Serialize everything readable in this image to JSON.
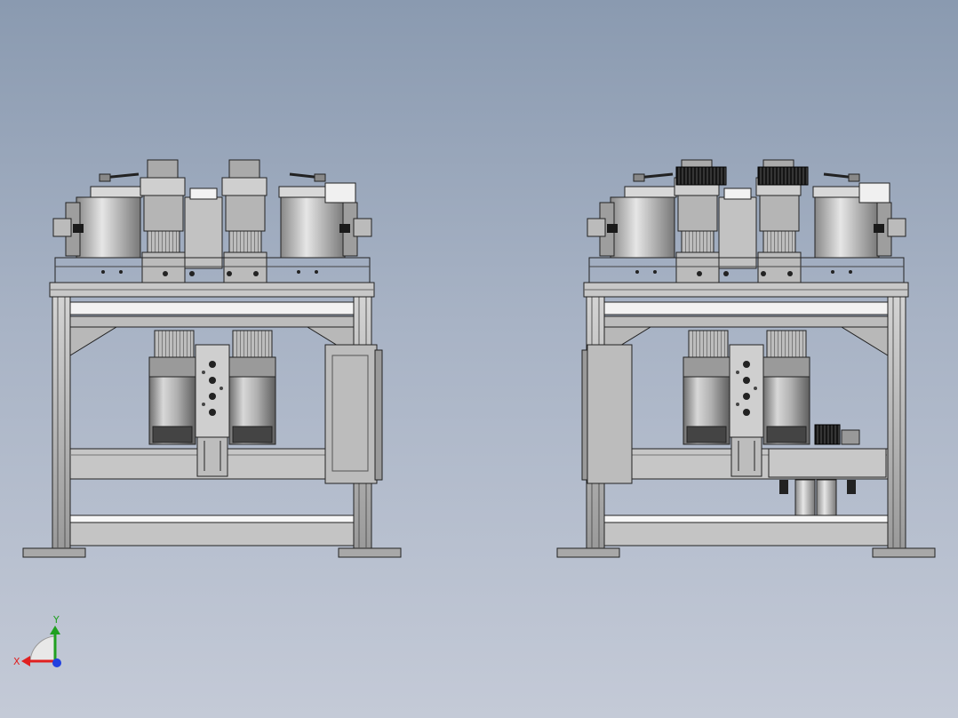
{
  "viewport": {
    "background_top": "#8a9ab0",
    "background_bottom": "#c4cad7"
  },
  "triad": {
    "x_label": "X",
    "y_label": "Y",
    "x_color": "#e02020",
    "y_color": "#20a020",
    "z_color": "#2040e0"
  },
  "models": [
    {
      "name": "machine-assembly-left",
      "variant": "standard"
    },
    {
      "name": "machine-assembly-right",
      "variant": "with-black-gears-and-side-unit"
    }
  ]
}
